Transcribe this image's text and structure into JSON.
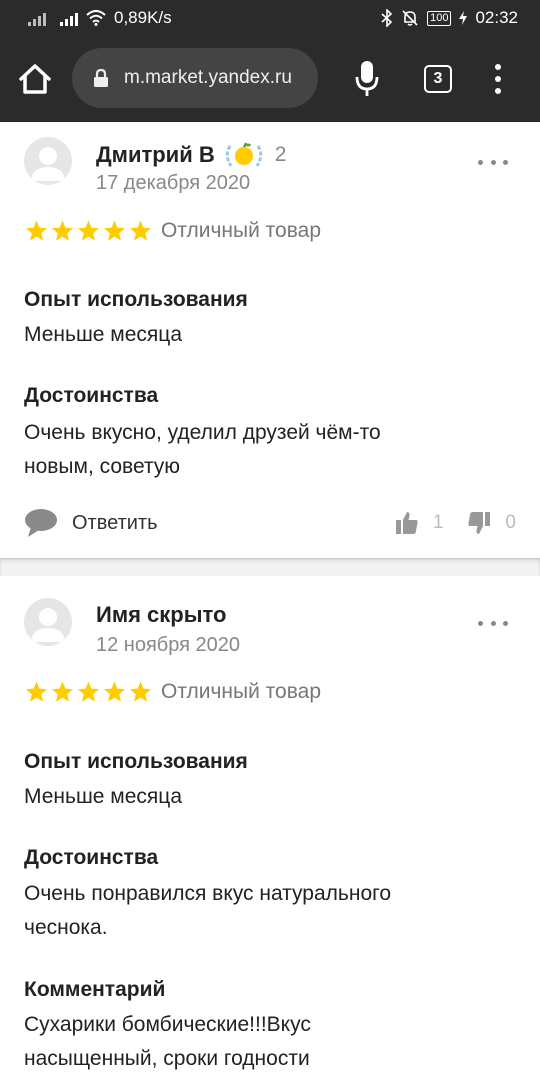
{
  "status_bar": {
    "speed": "0,89K/s",
    "battery": "100",
    "time": "02:32"
  },
  "browser": {
    "url": "m.market.yandex.ru",
    "tab_count": "3"
  },
  "reviews": [
    {
      "author": "Дмитрий В",
      "badge_count": "2",
      "date": "17 декабря 2020",
      "rating": 5,
      "rating_text": "Отличный товар",
      "sections": [
        {
          "title": "Опыт использования",
          "text": "Меньше месяца"
        },
        {
          "title": "Достоинства",
          "text": "Очень вкусно, уделил друзей чём-то новым, советую"
        }
      ],
      "reply_label": "Ответить",
      "likes": "1",
      "dislikes": "0"
    },
    {
      "author": "Имя скрыто",
      "date": "12 ноября 2020",
      "rating": 5,
      "rating_text": "Отличный товар",
      "sections": [
        {
          "title": "Опыт использования",
          "text": "Меньше месяца"
        },
        {
          "title": "Достоинства",
          "text": "Очень понравился вкус натурального чеснока."
        },
        {
          "title": "Комментарий",
          "text": "Сухарики бомбические!!!Вкус насыщенный, сроки годности"
        }
      ]
    }
  ],
  "colors": {
    "star": "#FFCC00",
    "bar": "#2B2B2B"
  }
}
